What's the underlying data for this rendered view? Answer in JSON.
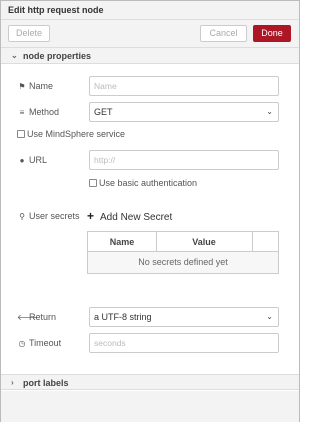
{
  "title": "Edit http request node",
  "toolbar": {
    "delete_label": "Delete",
    "cancel_label": "Cancel",
    "done_label": "Done"
  },
  "sections": {
    "properties_label": "node properties",
    "ports_label": "port labels"
  },
  "form": {
    "name_label": "Name",
    "name_placeholder": "Name",
    "method_label": "Method",
    "method_value": "GET",
    "mindsphere_label": "Use MindSphere service",
    "url_label": "URL",
    "url_placeholder": "http://",
    "basic_auth_label": "Use basic authentication",
    "user_secrets_label": "User secrets",
    "add_secret_label": "Add New Secret",
    "secrets_table": {
      "columns": [
        "Name",
        "Value"
      ],
      "empty_text": "No secrets defined yet"
    },
    "return_label": "Return",
    "return_value": "a UTF-8 string",
    "timeout_label": "Timeout",
    "timeout_placeholder": "seconds"
  },
  "icons": {
    "name": "tag-icon",
    "method": "list-icon",
    "url": "globe-icon",
    "user_secrets": "key-icon",
    "add": "plus-icon",
    "return": "arrow-left-icon",
    "timeout": "clock-icon"
  },
  "colors": {
    "done_button": "#ad1625",
    "header_bg": "#f3f3f3"
  }
}
